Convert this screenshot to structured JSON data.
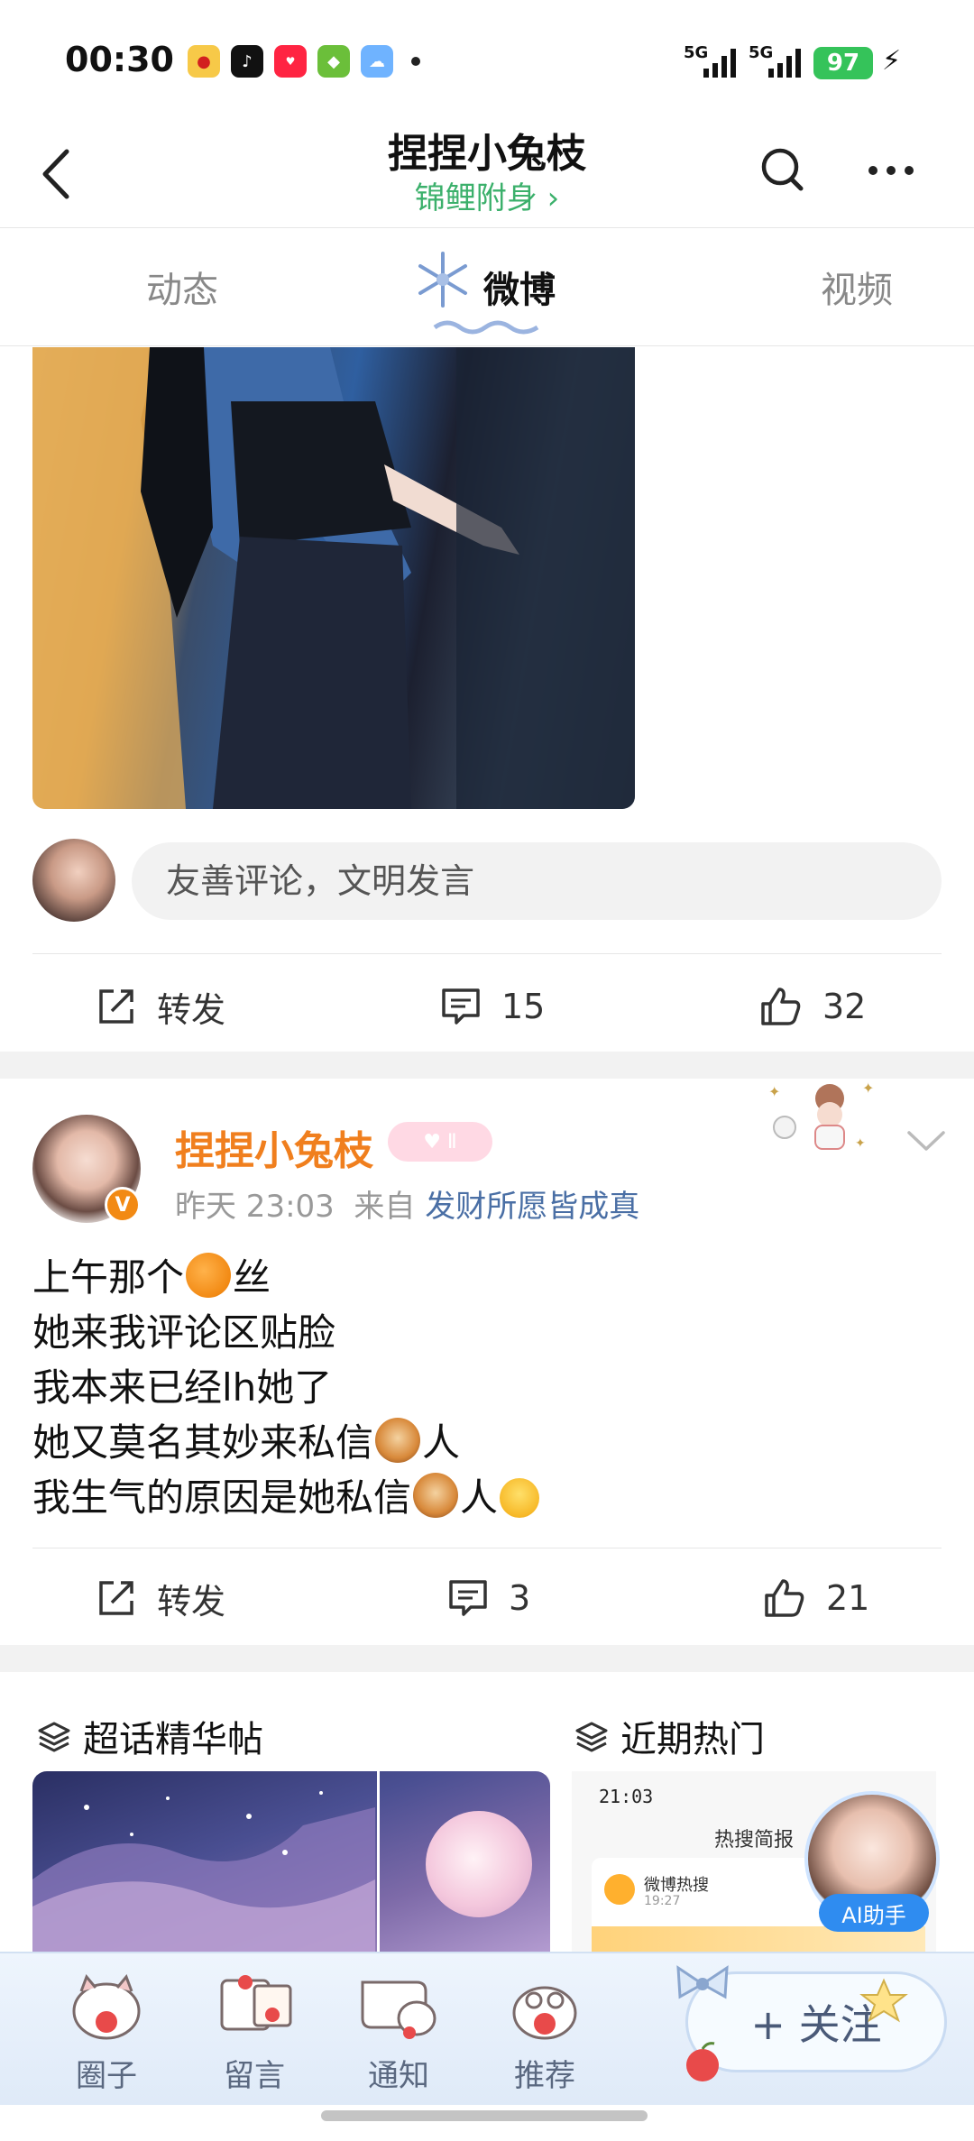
{
  "status_bar": {
    "time": "00:30",
    "signal_1": "5G",
    "signal_2": "5G",
    "battery": "97",
    "app_icons": [
      "weibo-icon",
      "tiktok-icon",
      "xiaohongshu-icon",
      "game-icon",
      "weather-icon"
    ]
  },
  "header": {
    "title": "捏捏小兔枝",
    "subtitle": "锦鲤附身 ›"
  },
  "tabs": [
    {
      "label": "动态"
    },
    {
      "label": "微博"
    },
    {
      "label": "视频"
    }
  ],
  "comment_box": {
    "placeholder": "友善评论，文明发言"
  },
  "post1_actions": {
    "repost": "转发",
    "comments": "15",
    "likes": "32"
  },
  "post2": {
    "author": "捏捏小兔枝",
    "time": "昨天 23:03",
    "from_label": "来自",
    "source": "发财所愿皆成真",
    "verified_mark": "V",
    "text_lines": [
      {
        "before": "上午那个",
        "after": "丝"
      },
      {
        "before": "她来我评论区贴脸",
        "after": ""
      },
      {
        "before": "我本来已经lh她了",
        "after": ""
      },
      {
        "before": "她又莫名其妙来私信",
        "after": "人"
      },
      {
        "before": "我生气的原因是她私信",
        "after": "人"
      }
    ],
    "actions": {
      "repost": "转发",
      "comments": "3",
      "likes": "21"
    }
  },
  "sections": {
    "left_title": "超话精华帖",
    "right_title": "近期热门",
    "screenshot": {
      "time": "21:03",
      "title": "热搜简报",
      "account": "微博热搜",
      "date": "19:27"
    },
    "ai_assistant": "AI助手"
  },
  "bottom_bar": {
    "items": [
      "圈子",
      "留言",
      "通知",
      "推荐"
    ],
    "follow": "+ 关注"
  },
  "colors": {
    "accent_orange": "#f07f1e",
    "brand_green": "#3bb06b",
    "link_blue": "#4a6fa5",
    "battery_green": "#35c35a"
  }
}
